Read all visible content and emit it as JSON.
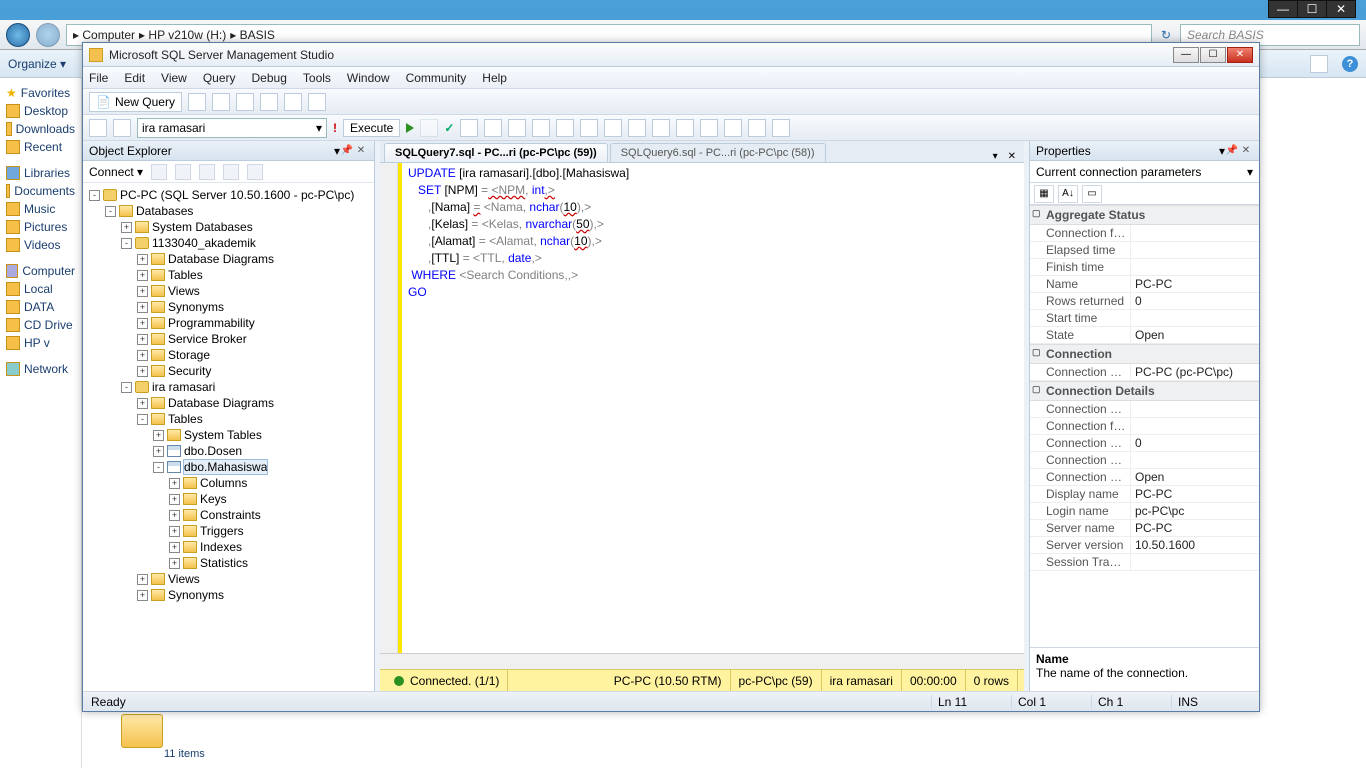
{
  "explorer": {
    "breadcrumb": [
      "Computer",
      "HP v210w (H:)",
      "BASIS"
    ],
    "search_placeholder": "Search BASIS",
    "organize": "Organize ▾",
    "sidebar": {
      "favorites": "Favorites",
      "desktop": "Desktop",
      "downloads": "Downloads",
      "recent": "Recent",
      "libraries": "Libraries",
      "documents": "Documents",
      "music": "Music",
      "pictures": "Pictures",
      "videos": "Videos",
      "computer": "Computer",
      "local": "Local",
      "dat": "DATA",
      "cd": "CD Drive",
      "hp": "HP v",
      "network": "Network"
    },
    "footer": "11 items"
  },
  "ssms": {
    "title": "Microsoft SQL Server Management Studio",
    "menu": [
      "File",
      "Edit",
      "View",
      "Query",
      "Debug",
      "Tools",
      "Window",
      "Community",
      "Help"
    ],
    "new_query": "New Query",
    "db": "ira ramasari",
    "execute": "Execute",
    "object_explorer": {
      "title": "Object Explorer",
      "connect": "Connect ▾",
      "root": "PC-PC (SQL Server 10.50.1600 - pc-PC\\pc)",
      "databases": "Databases",
      "sysdb": "System Databases",
      "db1": "1133040_akademik",
      "db2": "ira ramasari",
      "dbdiag": "Database Diagrams",
      "tables": "Tables",
      "views": "Views",
      "synonyms": "Synonyms",
      "programmability": "Programmability",
      "servicebroker": "Service Broker",
      "storage": "Storage",
      "security": "Security",
      "systables": "System Tables",
      "dbo_dosen": "dbo.Dosen",
      "dbo_mahasiswa": "dbo.Mahasiswa",
      "columns": "Columns",
      "keys": "Keys",
      "constraints": "Constraints",
      "triggers": "Triggers",
      "indexes": "Indexes",
      "statistics": "Statistics"
    },
    "tabs": {
      "active": "SQLQuery7.sql - PC...ri (pc-PC\\pc (59))",
      "inactive": "SQLQuery6.sql - PC...ri (pc-PC\\pc (58))"
    },
    "sql": {
      "l1a": "UPDATE",
      "l1b": " [ira ramasari].[dbo].[Mahasiswa]",
      "l2a": "   SET",
      "l2b": " [NPM] ",
      "l2c": "=",
      "l2d": " <NPM",
      "l2e": ",",
      "l2f": " int",
      "l2g": ",>",
      "l3a": "      ",
      "l3b": ",",
      "l3c": "[Nama] ",
      "l3d": "=",
      "l3e": " <Nama",
      "l3f": ",",
      "l3g": " nchar",
      "l3h": "(",
      "l3i": "10",
      "l3j": ")",
      "l3k": ",>",
      "l4a": "      ",
      "l4b": ",",
      "l4c": "[Kelas] ",
      "l4d": "=",
      "l4e": " <Kelas",
      "l4f": ",",
      "l4g": " nvarchar",
      "l4h": "(",
      "l4i": "50",
      "l4j": ")",
      "l4k": ",>",
      "l5a": "      ",
      "l5b": ",",
      "l5c": "[Alamat] ",
      "l5d": "=",
      "l5e": " <Alamat",
      "l5f": ",",
      "l5g": " nchar",
      "l5h": "(",
      "l5i": "10",
      "l5j": ")",
      "l5k": ",>",
      "l6a": "      ",
      "l6b": ",",
      "l6c": "[TTL] ",
      "l6d": "=",
      "l6e": " <TTL",
      "l6f": ",",
      "l6g": " date",
      "l6h": ",>",
      "l7a": " WHERE",
      "l7b": " <Search Conditions,,>",
      "l8": "GO"
    },
    "ed_status": {
      "connected": "Connected. (1/1)",
      "server": "PC-PC (10.50 RTM)",
      "user": "pc-PC\\pc (59)",
      "db": "ira ramasari",
      "time": "00:00:00",
      "rows": "0 rows"
    },
    "properties": {
      "title": "Properties",
      "dropdown": "Current connection parameters",
      "cat_agg": "Aggregate Status",
      "connection_failure": "Connection failure",
      "elapsed": "Elapsed time",
      "finish": "Finish time",
      "name": "Name",
      "name_v": "PC-PC",
      "rows_ret": "Rows returned",
      "rows_ret_v": "0",
      "start": "Start time",
      "state": "State",
      "state_v": "Open",
      "cat_conn": "Connection",
      "conn_name": "Connection name",
      "conn_name_v": "PC-PC (pc-PC\\pc)",
      "cat_det": "Connection Details",
      "conn_elaps": "Connection elapsed",
      "conn_finish": "Connection finish",
      "conn_rows": "Connection rows",
      "conn_rows_v": "0",
      "conn_start": "Connection start",
      "conn_state": "Connection state",
      "conn_state_v": "Open",
      "disp_name": "Display name",
      "disp_name_v": "PC-PC",
      "login": "Login name",
      "login_v": "pc-PC\\pc",
      "srv_name": "Server name",
      "srv_name_v": "PC-PC",
      "srv_ver": "Server version",
      "srv_ver_v": "10.50.1600",
      "sess_trace": "Session Tracing ID",
      "desc_name": "Name",
      "desc_text": "The name of the connection."
    },
    "status": {
      "ready": "Ready",
      "ln": "Ln 11",
      "col": "Col 1",
      "ch": "Ch 1",
      "ins": "INS"
    }
  }
}
